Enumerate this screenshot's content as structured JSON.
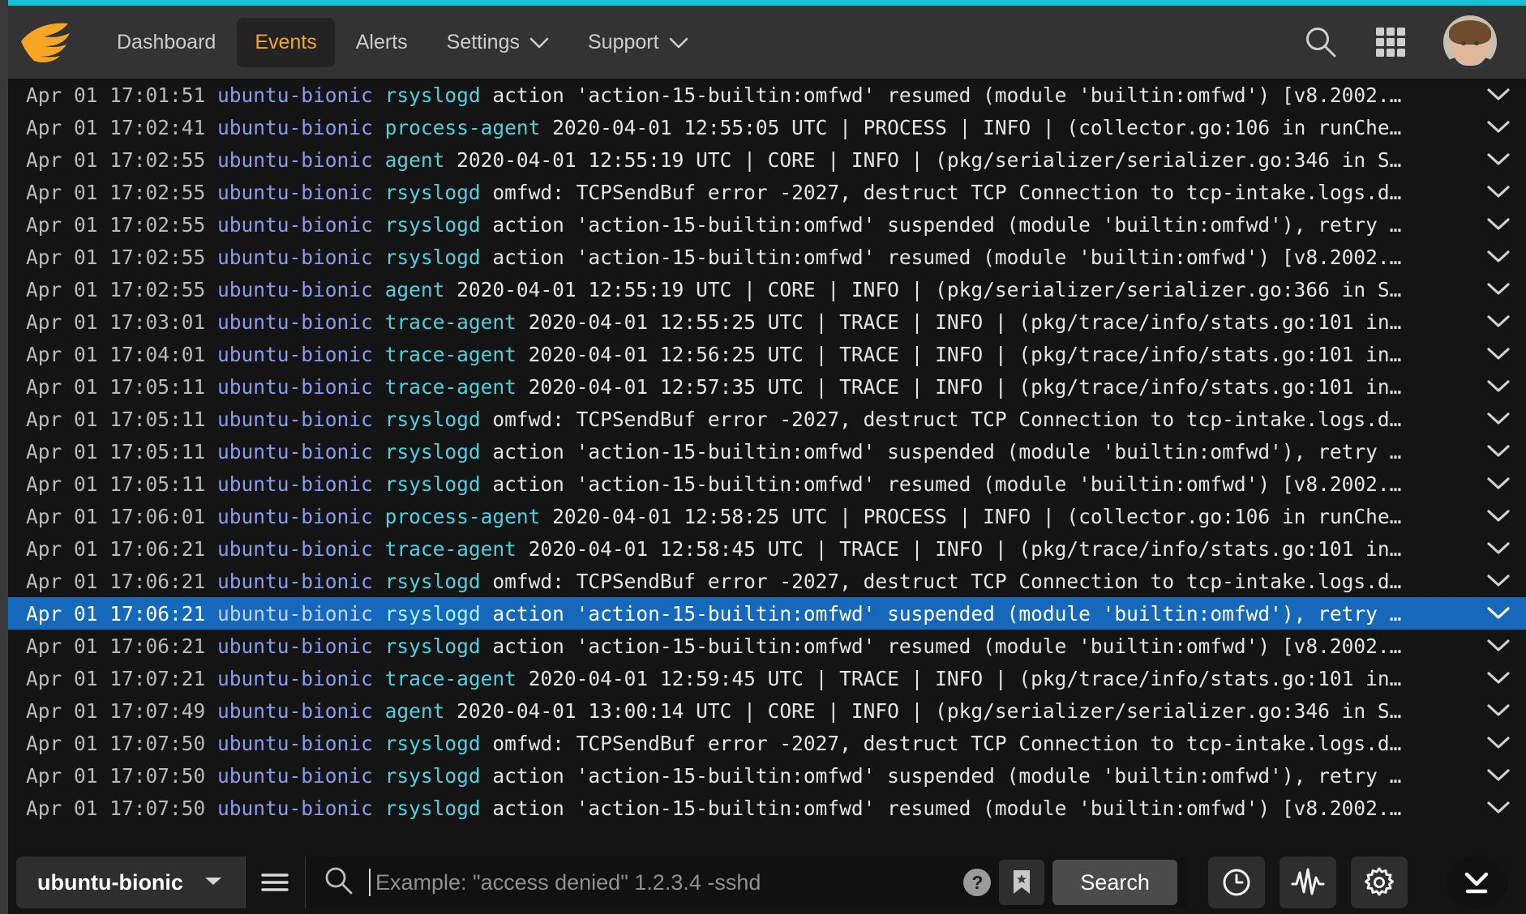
{
  "theme": {
    "accent_bar_color": "#17bfd3",
    "brand_orange": "#f5a623",
    "header_bg": "#333333",
    "log_bg": "#141414",
    "selected_row_bg": "#1669ba",
    "host_color": "#8a9cf0",
    "process_color": "#4fd0de"
  },
  "header": {
    "logo_name": "solarwinds-logo",
    "nav": [
      {
        "label": "Dashboard",
        "active": false,
        "has_caret": false
      },
      {
        "label": "Events",
        "active": true,
        "has_caret": false
      },
      {
        "label": "Alerts",
        "active": false,
        "has_caret": false
      },
      {
        "label": "Settings",
        "active": false,
        "has_caret": true
      },
      {
        "label": "Support",
        "active": false,
        "has_caret": true
      }
    ],
    "search_icon": "search-icon",
    "apps_icon": "apps-grid-icon",
    "avatar": "user-avatar"
  },
  "log": {
    "rows": [
      {
        "time": "Apr 01 17:01:51",
        "host": "ubuntu-bionic",
        "proc": "rsyslogd",
        "msg": "action 'action-15-builtin:omfwd' resumed (module 'builtin:omfwd') [v8.2002.…",
        "selected": false
      },
      {
        "time": "Apr 01 17:02:41",
        "host": "ubuntu-bionic",
        "proc": "process-agent",
        "msg": "2020-04-01 12:55:05 UTC | PROCESS | INFO | (collector.go:106 in runChe…",
        "selected": false
      },
      {
        "time": "Apr 01 17:02:55",
        "host": "ubuntu-bionic",
        "proc": "agent",
        "msg": "2020-04-01 12:55:19 UTC | CORE | INFO | (pkg/serializer/serializer.go:346 in S…",
        "selected": false
      },
      {
        "time": "Apr 01 17:02:55",
        "host": "ubuntu-bionic",
        "proc": "rsyslogd",
        "msg": "omfwd: TCPSendBuf error -2027, destruct TCP Connection to tcp-intake.logs.d…",
        "selected": false
      },
      {
        "time": "Apr 01 17:02:55",
        "host": "ubuntu-bionic",
        "proc": "rsyslogd",
        "msg": "action 'action-15-builtin:omfwd' suspended (module 'builtin:omfwd'), retry …",
        "selected": false
      },
      {
        "time": "Apr 01 17:02:55",
        "host": "ubuntu-bionic",
        "proc": "rsyslogd",
        "msg": "action 'action-15-builtin:omfwd' resumed (module 'builtin:omfwd') [v8.2002.…",
        "selected": false
      },
      {
        "time": "Apr 01 17:02:55",
        "host": "ubuntu-bionic",
        "proc": "agent",
        "msg": "2020-04-01 12:55:19 UTC | CORE | INFO | (pkg/serializer/serializer.go:366 in S…",
        "selected": false
      },
      {
        "time": "Apr 01 17:03:01",
        "host": "ubuntu-bionic",
        "proc": "trace-agent",
        "msg": "2020-04-01 12:55:25 UTC | TRACE | INFO | (pkg/trace/info/stats.go:101 in…",
        "selected": false
      },
      {
        "time": "Apr 01 17:04:01",
        "host": "ubuntu-bionic",
        "proc": "trace-agent",
        "msg": "2020-04-01 12:56:25 UTC | TRACE | INFO | (pkg/trace/info/stats.go:101 in…",
        "selected": false
      },
      {
        "time": "Apr 01 17:05:11",
        "host": "ubuntu-bionic",
        "proc": "trace-agent",
        "msg": "2020-04-01 12:57:35 UTC | TRACE | INFO | (pkg/trace/info/stats.go:101 in…",
        "selected": false
      },
      {
        "time": "Apr 01 17:05:11",
        "host": "ubuntu-bionic",
        "proc": "rsyslogd",
        "msg": "omfwd: TCPSendBuf error -2027, destruct TCP Connection to tcp-intake.logs.d…",
        "selected": false
      },
      {
        "time": "Apr 01 17:05:11",
        "host": "ubuntu-bionic",
        "proc": "rsyslogd",
        "msg": "action 'action-15-builtin:omfwd' suspended (module 'builtin:omfwd'), retry …",
        "selected": false
      },
      {
        "time": "Apr 01 17:05:11",
        "host": "ubuntu-bionic",
        "proc": "rsyslogd",
        "msg": "action 'action-15-builtin:omfwd' resumed (module 'builtin:omfwd') [v8.2002.…",
        "selected": false
      },
      {
        "time": "Apr 01 17:06:01",
        "host": "ubuntu-bionic",
        "proc": "process-agent",
        "msg": "2020-04-01 12:58:25 UTC | PROCESS | INFO | (collector.go:106 in runChe…",
        "selected": false
      },
      {
        "time": "Apr 01 17:06:21",
        "host": "ubuntu-bionic",
        "proc": "trace-agent",
        "msg": "2020-04-01 12:58:45 UTC | TRACE | INFO | (pkg/trace/info/stats.go:101 in…",
        "selected": false
      },
      {
        "time": "Apr 01 17:06:21",
        "host": "ubuntu-bionic",
        "proc": "rsyslogd",
        "msg": "omfwd: TCPSendBuf error -2027, destruct TCP Connection to tcp-intake.logs.d…",
        "selected": false
      },
      {
        "time": "Apr 01 17:06:21",
        "host": "ubuntu-bionic",
        "proc": "rsyslogd",
        "msg": "action 'action-15-builtin:omfwd' suspended (module 'builtin:omfwd'), retry …",
        "selected": true
      },
      {
        "time": "Apr 01 17:06:21",
        "host": "ubuntu-bionic",
        "proc": "rsyslogd",
        "msg": "action 'action-15-builtin:omfwd' resumed (module 'builtin:omfwd') [v8.2002.…",
        "selected": false
      },
      {
        "time": "Apr 01 17:07:21",
        "host": "ubuntu-bionic",
        "proc": "trace-agent",
        "msg": "2020-04-01 12:59:45 UTC | TRACE | INFO | (pkg/trace/info/stats.go:101 in…",
        "selected": false
      },
      {
        "time": "Apr 01 17:07:49",
        "host": "ubuntu-bionic",
        "proc": "agent",
        "msg": "2020-04-01 13:00:14 UTC | CORE | INFO | (pkg/serializer/serializer.go:346 in S…",
        "selected": false
      },
      {
        "time": "Apr 01 17:07:50",
        "host": "ubuntu-bionic",
        "proc": "rsyslogd",
        "msg": "omfwd: TCPSendBuf error -2027, destruct TCP Connection to tcp-intake.logs.d…",
        "selected": false
      },
      {
        "time": "Apr 01 17:07:50",
        "host": "ubuntu-bionic",
        "proc": "rsyslogd",
        "msg": "action 'action-15-builtin:omfwd' suspended (module 'builtin:omfwd'), retry …",
        "selected": false
      },
      {
        "time": "Apr 01 17:07:50",
        "host": "ubuntu-bionic",
        "proc": "rsyslogd",
        "msg": "action 'action-15-builtin:omfwd' resumed (module 'builtin:omfwd') [v8.2002.…",
        "selected": false
      }
    ],
    "row_expand_icon": "chevron-down-icon"
  },
  "bottombar": {
    "host_filter": {
      "value": "ubuntu-bionic",
      "caret_icon": "caret-down-icon"
    },
    "filter_menu_icon": "hamburger-menu-icon",
    "search": {
      "icon": "search-icon",
      "value": "",
      "placeholder": "Example: \"access denied\" 1.2.3.4 -sshd"
    },
    "help_label": "?",
    "bookmark_icon": "bookmark-star-icon",
    "search_button_label": "Search",
    "tools": [
      {
        "name": "history-clock-icon"
      },
      {
        "name": "activity-pulse-icon"
      },
      {
        "name": "settings-gear-icon"
      }
    ],
    "jump_to_bottom_icon": "jump-to-bottom-icon"
  }
}
